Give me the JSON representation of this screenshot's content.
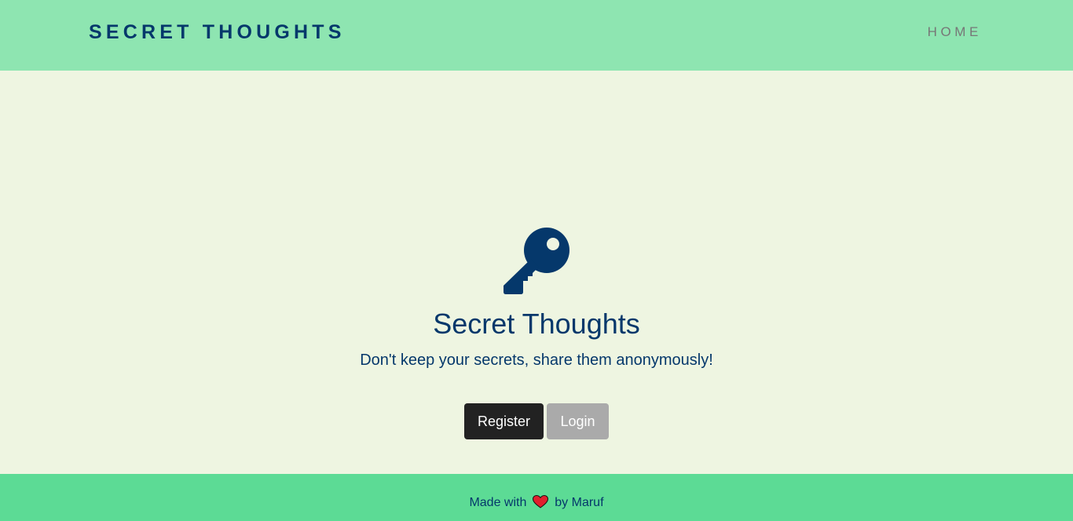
{
  "navbar": {
    "brand": "SECRET THOUGHTS",
    "links": [
      {
        "label": "HOME"
      }
    ]
  },
  "hero": {
    "icon": "key-icon",
    "title": "Secret Thoughts",
    "subtitle": "Don't keep your secrets, share them anonymously!",
    "buttons": {
      "register_label": "Register",
      "login_label": "Login"
    }
  },
  "footer": {
    "prefix": "Made with",
    "icon": "heart-icon",
    "suffix": "by Maruf"
  },
  "colors": {
    "navbar_bg": "#8ee5b1",
    "page_bg": "#eef5e1",
    "footer_bg": "#5cdb95",
    "primary_text": "#05386b",
    "register_bg": "#222222",
    "login_bg": "#aaaaaa",
    "heart": "#e0202e"
  }
}
